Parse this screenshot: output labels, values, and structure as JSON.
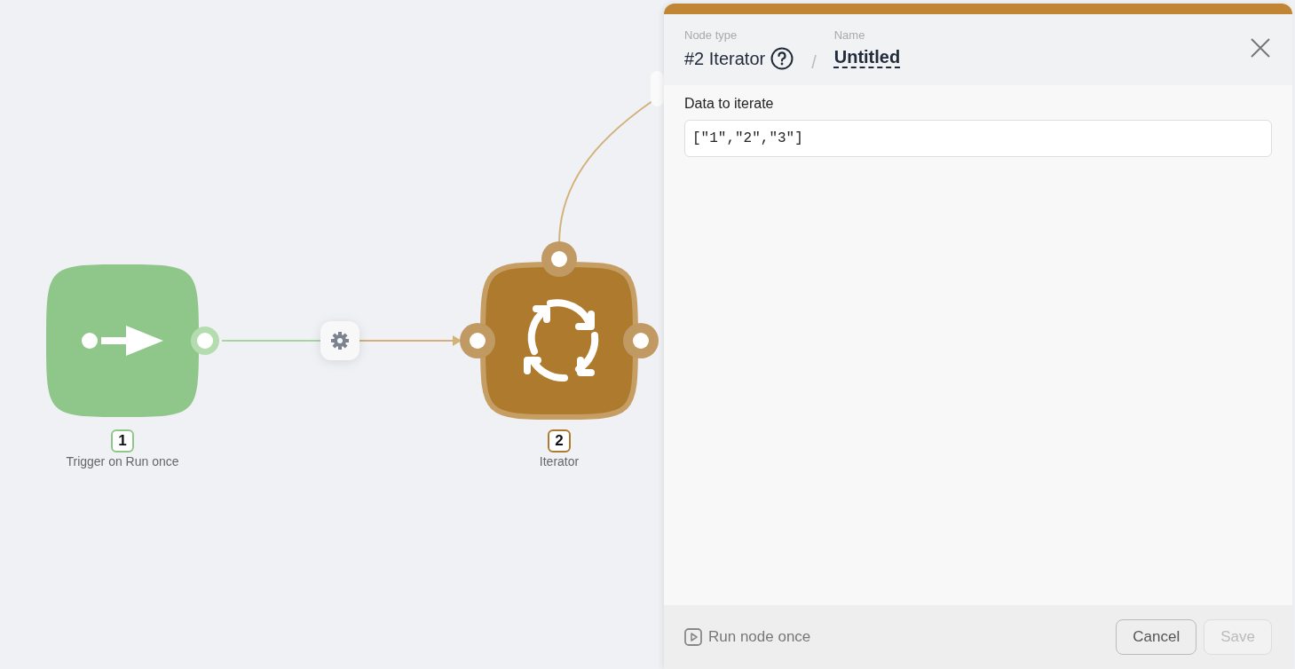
{
  "canvas": {
    "nodes": [
      {
        "number": "1",
        "label": "Trigger on Run once",
        "kind": "trigger",
        "color": "#8fc689"
      },
      {
        "number": "2",
        "label": "Iterator",
        "kind": "iterator",
        "color": "#ad7a2e"
      }
    ]
  },
  "panel": {
    "node_type_label": "Node type",
    "node_type": "#2 Iterator",
    "name_label": "Name",
    "separator": "/",
    "name": "Untitled",
    "field_label": "Data to iterate",
    "field_value": "[\"1\",\"2\",\"3\"]",
    "run_label": "Run node once",
    "buttons": [
      {
        "label": "Cancel",
        "disabled": false
      },
      {
        "label": "Save",
        "disabled": true
      }
    ]
  }
}
